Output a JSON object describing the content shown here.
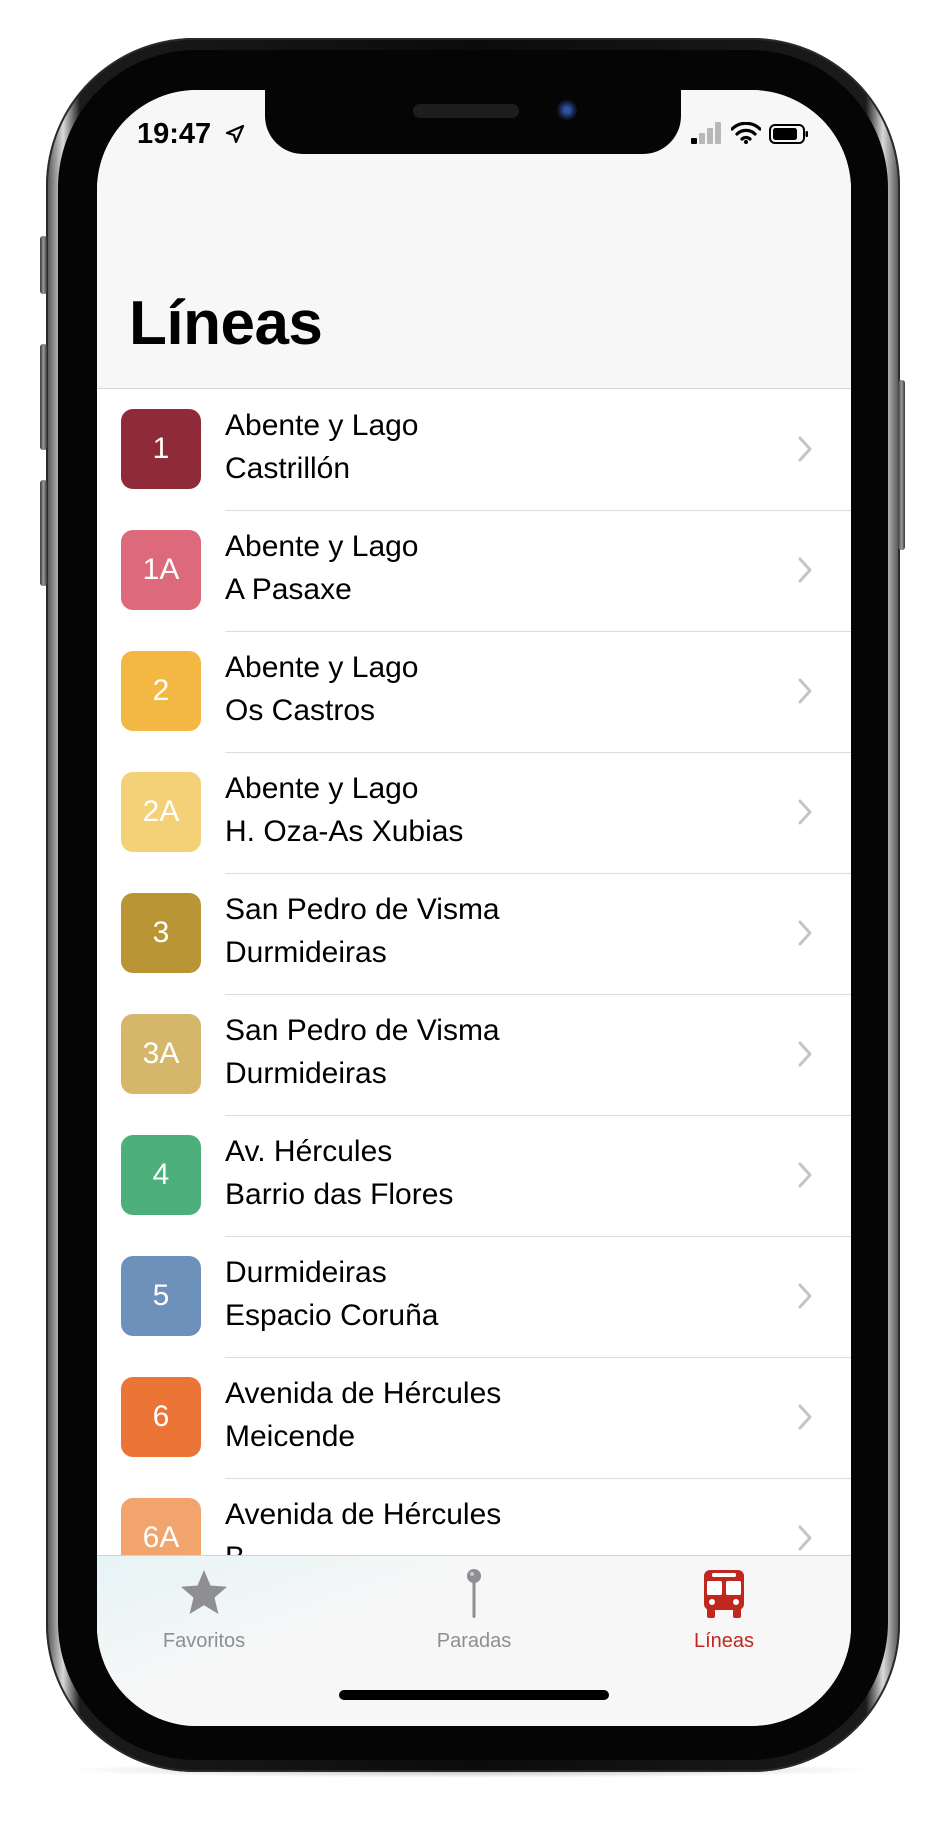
{
  "status_bar": {
    "time": "19:47"
  },
  "header": {
    "title": "Líneas"
  },
  "lines": [
    {
      "code": "1",
      "color": "#8f2a38",
      "line1": "Abente y Lago",
      "line2": "Castrillón"
    },
    {
      "code": "1A",
      "color": "#dc6a7a",
      "line1": "Abente y Lago",
      "line2": "A Pasaxe"
    },
    {
      "code": "2",
      "color": "#f2b843",
      "line1": "Abente y Lago",
      "line2": "Os Castros"
    },
    {
      "code": "2A",
      "color": "#f4d076",
      "line1": "Abente y Lago",
      "line2": "H. Oza-As Xubias"
    },
    {
      "code": "3",
      "color": "#b99536",
      "line1": "San Pedro de Visma",
      "line2": "Durmideiras"
    },
    {
      "code": "3A",
      "color": "#d4b76a",
      "line1": "San Pedro de Visma",
      "line2": "Durmideiras"
    },
    {
      "code": "4",
      "color": "#4caf7c",
      "line1": "Av. Hércules",
      "line2": "Barrio das Flores"
    },
    {
      "code": "5",
      "color": "#6d91bb",
      "line1": "Durmideiras",
      "line2": "Espacio Coruña"
    },
    {
      "code": "6",
      "color": "#eb7536",
      "line1": "Avenida de Hércules",
      "line2": "Meicende"
    },
    {
      "code": "6A",
      "color": "#f1a46c",
      "line1": "Avenida de Hércules",
      "line2": "B..."
    }
  ],
  "tabs": [
    {
      "label": "Favoritos",
      "icon": "star-icon",
      "active": false
    },
    {
      "label": "Paradas",
      "icon": "stop-pin-icon",
      "active": false
    },
    {
      "label": "Líneas",
      "icon": "bus-icon",
      "active": true
    }
  ],
  "colors": {
    "accent": "#c0281f",
    "inactive_tab": "#8e8e93",
    "chevron": "#c4c4c7"
  }
}
